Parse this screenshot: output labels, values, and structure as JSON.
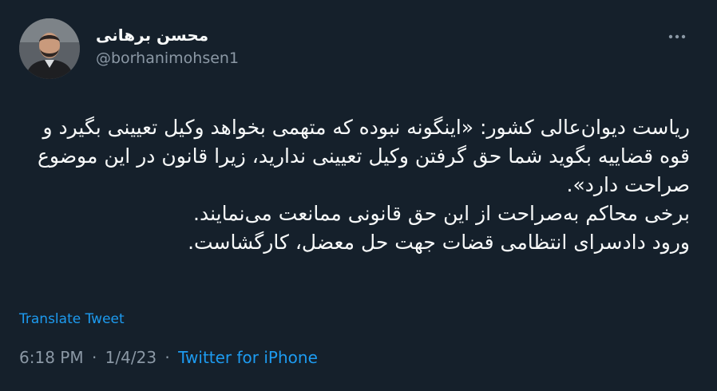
{
  "author": {
    "display_name": "محسن برهانی",
    "handle": "@borhanimohsen1"
  },
  "tweet": {
    "text": "ریاست دیوان‌عالی کشور: «اینگونه نبوده که متهمی بخواهد وکیل تعیینی بگیرد و قوه قضاییه بگوید شما حق گرفتن وکیل تعیینی ندارید، زیرا قانون در این موضوع صراحت دارد».\nبرخی محاکم به‌صراحت از این حق قانونی ممانعت می‌نمایند.\nورود دادسرای انتظامی قضات جهت حل معضل، کارگشاست.",
    "translate_label": "Translate Tweet",
    "time": "6:18 PM",
    "separator": "·",
    "date": "1/4/23",
    "source": "Twitter for iPhone"
  },
  "icons": {
    "more": "more-dots-icon",
    "avatar": "profile-photo"
  },
  "colors": {
    "background": "#15202b",
    "text": "#f7f9f9",
    "secondary": "#8b98a5",
    "link": "#1d9bf0"
  }
}
